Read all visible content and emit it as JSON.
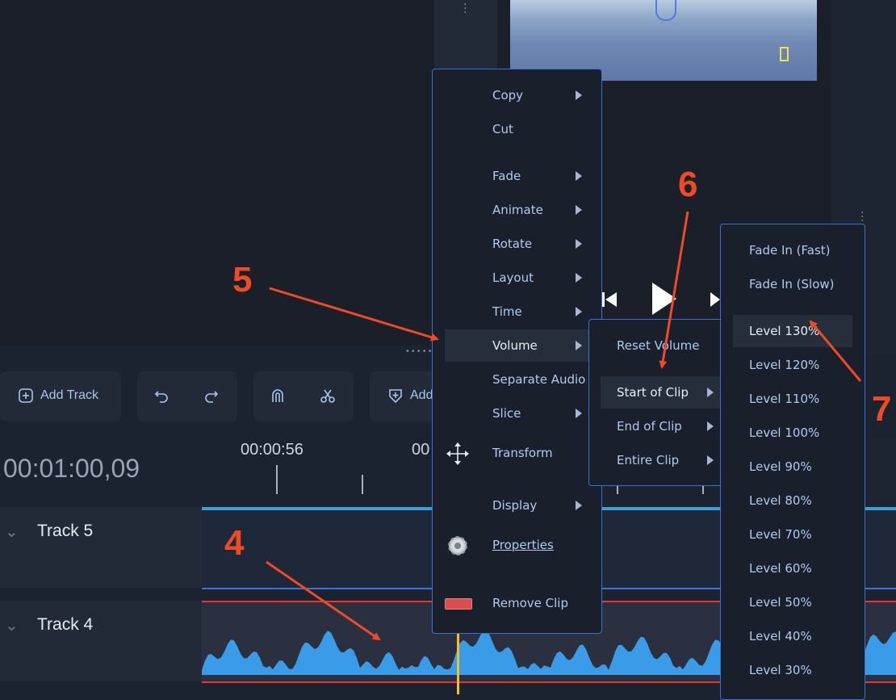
{
  "toolbar": {
    "add_track": "Add Track",
    "add_partial": "Add"
  },
  "timeline": {
    "timecode": "00:01:00,09",
    "ruler_time_1": "00:00:56",
    "ruler_time_2": "00"
  },
  "tracks": [
    {
      "name": "Track 5"
    },
    {
      "name": "Track 4"
    }
  ],
  "context_menu": {
    "items": [
      {
        "label": "Copy"
      },
      {
        "label": "Cut"
      },
      {
        "label": "Fade"
      },
      {
        "label": "Animate"
      },
      {
        "label": "Rotate"
      },
      {
        "label": "Layout"
      },
      {
        "label": "Time"
      },
      {
        "label": "Volume"
      },
      {
        "label": "Separate Audio"
      },
      {
        "label": "Slice"
      },
      {
        "label": "Transform"
      },
      {
        "label": "Display"
      },
      {
        "label": "Properties"
      },
      {
        "label": "Remove Clip"
      }
    ]
  },
  "volume_menu": {
    "items": [
      {
        "label": "Reset Volume"
      },
      {
        "label": "Start of Clip"
      },
      {
        "label": "End of Clip"
      },
      {
        "label": "Entire Clip"
      }
    ]
  },
  "level_menu": {
    "items": [
      {
        "label": "Fade In (Fast)"
      },
      {
        "label": "Fade In (Slow)"
      },
      {
        "label": "Level 130%"
      },
      {
        "label": "Level 120%"
      },
      {
        "label": "Level 110%"
      },
      {
        "label": "Level 100%"
      },
      {
        "label": "Level 90%"
      },
      {
        "label": "Level 80%"
      },
      {
        "label": "Level 70%"
      },
      {
        "label": "Level 60%"
      },
      {
        "label": "Level 50%"
      },
      {
        "label": "Level 40%"
      },
      {
        "label": "Level 30%"
      }
    ]
  },
  "callouts": {
    "c4": "4",
    "c5": "5",
    "c6": "6",
    "c7": "7"
  },
  "colors": {
    "accent": "#3b6fd4",
    "callout": "#ee4a26",
    "waveform": "#3a9be8",
    "playhead": "#f0c229"
  }
}
